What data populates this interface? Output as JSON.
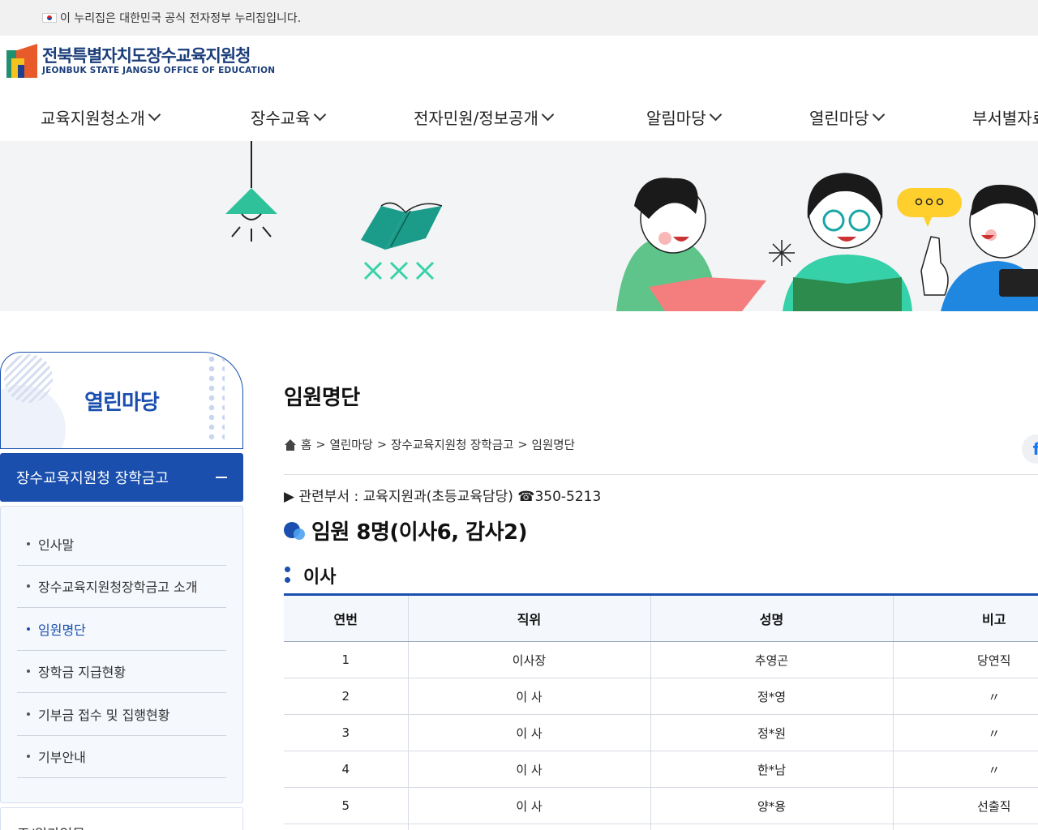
{
  "gov_banner": {
    "text": "이 누리집은 대한민국 공식 전자정부 누리집입니다."
  },
  "logo": {
    "name_ko": "전북특별자치도장수교육지원청",
    "name_en": "JEONBUK STATE JANGSU OFFICE OF EDUCATION"
  },
  "gnb": [
    {
      "label": "교육지원청소개"
    },
    {
      "label": "장수교육"
    },
    {
      "label": "전자민원/정보공개"
    },
    {
      "label": "알림마당"
    },
    {
      "label": "열린마당"
    },
    {
      "label": "부서별자료"
    }
  ],
  "sidebar": {
    "title": "열린마당",
    "active": "장수교육지원청 장학금고",
    "items": [
      {
        "label": "인사말"
      },
      {
        "label": "장수교육지원청장학금고 소개"
      },
      {
        "label": "임원명단"
      },
      {
        "label": "장학금 지급현황"
      },
      {
        "label": "기부금 접수 및 집행현황"
      },
      {
        "label": "기부안내"
      }
    ],
    "next": "조/원가업무"
  },
  "content": {
    "title": "임원명단",
    "breadcrumb": [
      "홈",
      "열린마당",
      "장수교육지원청 장학금고",
      "임원명단"
    ],
    "breadcrumb_sep": ">",
    "dept": "▶ 관련부서 : 교육지원과(초등교육담당) ☎350-5213",
    "heading": "임원 8명(이사6, 감사2)",
    "subheading": "이사",
    "table": {
      "headers": [
        "연번",
        "직위",
        "성명",
        "비고"
      ],
      "rows": [
        [
          "1",
          "이사장",
          "추영곤",
          "당연직"
        ],
        [
          "2",
          "이 사",
          "정*영",
          "〃"
        ],
        [
          "3",
          "이 사",
          "정*원",
          "〃"
        ],
        [
          "4",
          "이 사",
          "한*남",
          "〃"
        ],
        [
          "5",
          "이 사",
          "양*용",
          "선출직"
        ],
        [
          "",
          "",
          "",
          ""
        ]
      ]
    }
  },
  "icons": {
    "home": "home-icon",
    "facebook": "facebook-icon"
  },
  "colors": {
    "accent": "#1a4fae",
    "banner_bg": "#f3f4f6"
  }
}
